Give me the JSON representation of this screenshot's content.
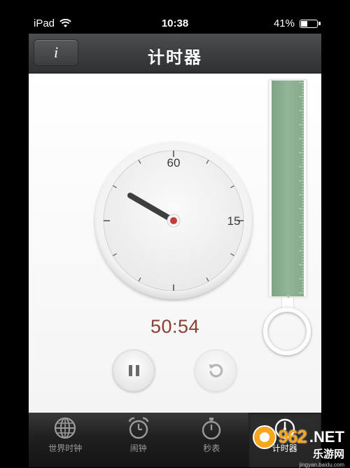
{
  "status_bar": {
    "device": "iPad",
    "time": "10:38",
    "battery": "41%",
    "battery_level": 0.41
  },
  "nav": {
    "info_label": "i",
    "title": "计时器"
  },
  "dial": {
    "label_top": "60",
    "label_right": "15",
    "hand_color": "#3e3e3e",
    "center_color": "#c8393a"
  },
  "timer": {
    "display": "50:54",
    "color": "#8a3f34"
  },
  "tabs": [
    {
      "label": "世界时钟",
      "icon": "globe-icon",
      "active": false
    },
    {
      "label": "闹钟",
      "icon": "alarm-clock-icon",
      "active": false
    },
    {
      "label": "秒表",
      "icon": "stopwatch-icon",
      "active": false
    },
    {
      "label": "计时器",
      "icon": "timer-icon",
      "active": true
    }
  ],
  "watermark": {
    "logo": "962",
    "suffix": ".NET",
    "name": "乐游网",
    "url": "jingyan.baidu.com"
  }
}
